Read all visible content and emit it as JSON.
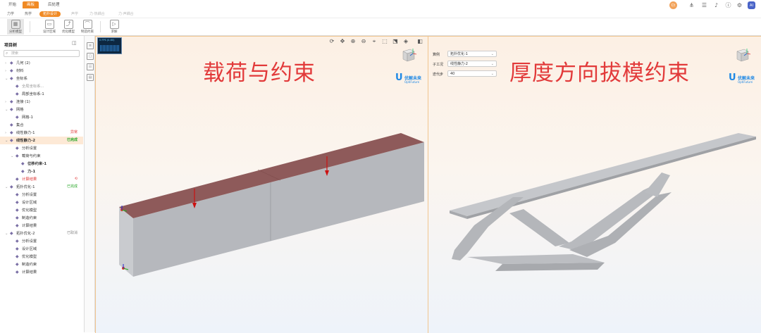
{
  "top_tabs": [
    "开始",
    "画板",
    "后处理"
  ],
  "top_tabs_active_index": 1,
  "top_right": {
    "user_initials": "Ct",
    "avatar_initials": "AI"
  },
  "ribbon_tabs": [
    "力学",
    "热学",
    "拓扑设计",
    "声学",
    "力·热耦合",
    "力·声耦合"
  ],
  "ribbon_active_index": 2,
  "tools": [
    {
      "label": "分析模型",
      "icon": "model-icon"
    },
    {
      "label": "设计区域",
      "icon": "design-region-icon"
    },
    {
      "label": "优化模型",
      "icon": "optimize-icon"
    },
    {
      "label": "制造约束",
      "icon": "manufacture-icon"
    },
    {
      "label": "求解",
      "icon": "solve-icon"
    }
  ],
  "project_tree": {
    "title": "项目树",
    "search_placeholder": "搜索",
    "items": [
      {
        "label": "几何 (2)",
        "indent": 0,
        "arrow": "›",
        "icon": "geometry-icon",
        "style": ""
      },
      {
        "label": "材料",
        "indent": 0,
        "arrow": "›",
        "icon": "material-icon",
        "style": ""
      },
      {
        "label": "坐标系",
        "indent": 0,
        "arrow": "⌄",
        "icon": "coordinate-icon",
        "style": ""
      },
      {
        "label": "全局坐标系...",
        "indent": 1,
        "arrow": "",
        "icon": "coordinate-icon",
        "style": "dim"
      },
      {
        "label": "局部坐标系-1",
        "indent": 1,
        "arrow": "",
        "icon": "coordinate-icon",
        "style": ""
      },
      {
        "label": "连接 (1)",
        "indent": 0,
        "arrow": "›",
        "icon": "connection-icon",
        "style": ""
      },
      {
        "label": "网格",
        "indent": 0,
        "arrow": "⌄",
        "icon": "mesh-icon",
        "style": ""
      },
      {
        "label": "网格-1",
        "indent": 1,
        "arrow": "",
        "icon": "mesh-icon",
        "style": ""
      },
      {
        "label": "集合",
        "indent": 0,
        "arrow": "",
        "icon": "set-icon",
        "style": ""
      },
      {
        "label": "线性静力-1",
        "indent": 0,
        "arrow": "›",
        "icon": "static-icon",
        "style": "",
        "badge": "异常",
        "badge_class": "b-red"
      },
      {
        "label": "线性静力-2",
        "indent": 0,
        "arrow": "⌄",
        "icon": "static-icon",
        "style": "bold sel",
        "badge": "已完成",
        "badge_class": "b-green"
      },
      {
        "label": "分析设置",
        "indent": 1,
        "arrow": "",
        "icon": "settings-icon",
        "style": ""
      },
      {
        "label": "载荷与约束",
        "indent": 1,
        "arrow": "⌄",
        "icon": "load-icon",
        "style": ""
      },
      {
        "label": "位移约束-1",
        "indent": 2,
        "arrow": "",
        "icon": "constraint-icon",
        "style": "bold"
      },
      {
        "label": "力-1",
        "indent": 2,
        "arrow": "",
        "icon": "force-icon",
        "style": "bold"
      },
      {
        "label": "计算结果",
        "indent": 1,
        "arrow": "",
        "icon": "result-icon",
        "style": "red",
        "badge": "⟲",
        "badge_class": "b-red"
      },
      {
        "label": "拓扑优化-1",
        "indent": 0,
        "arrow": "⌄",
        "icon": "topology-icon",
        "style": "",
        "badge": "已完成",
        "badge_class": "b-green"
      },
      {
        "label": "分析设置",
        "indent": 1,
        "arrow": "",
        "icon": "settings-icon",
        "style": ""
      },
      {
        "label": "设计区域",
        "indent": 1,
        "arrow": "",
        "icon": "design-region-icon",
        "style": ""
      },
      {
        "label": "优化模型",
        "indent": 1,
        "arrow": "",
        "icon": "optimize-icon",
        "style": ""
      },
      {
        "label": "制造约束",
        "indent": 1,
        "arrow": "",
        "icon": "manufacture-icon",
        "style": ""
      },
      {
        "label": "计算结果",
        "indent": 1,
        "arrow": "",
        "icon": "result-icon",
        "style": ""
      },
      {
        "label": "拓扑优化-2",
        "indent": 0,
        "arrow": "⌄",
        "icon": "topology-icon",
        "style": "",
        "badge": "已取消",
        "badge_class": "b-gray"
      },
      {
        "label": "分析设置",
        "indent": 1,
        "arrow": "",
        "icon": "settings-icon",
        "style": ""
      },
      {
        "label": "设计区域",
        "indent": 1,
        "arrow": "",
        "icon": "design-region-icon",
        "style": ""
      },
      {
        "label": "优化模型",
        "indent": 1,
        "arrow": "",
        "icon": "optimize-icon",
        "style": ""
      },
      {
        "label": "制造约束",
        "indent": 1,
        "arrow": "",
        "icon": "manufacture-icon",
        "style": ""
      },
      {
        "label": "计算结果",
        "indent": 1,
        "arrow": "",
        "icon": "result-icon",
        "style": ""
      }
    ]
  },
  "viewport1": {
    "title": "载荷与约束",
    "minimap_text": "0 FPS (0-60)"
  },
  "viewport2": {
    "title": "厚度方向拔模约束",
    "props": [
      {
        "label": "算例",
        "value": "拓扑优化-1"
      },
      {
        "label": "子工况",
        "value": "线性静力-2"
      },
      {
        "label": "迭代步",
        "value": "40"
      }
    ]
  },
  "logo": {
    "cn": "优解未来",
    "en": "OptiFuture",
    "mark": "U"
  },
  "colors": {
    "accent": "#f08a24",
    "title_red": "#e23a3a",
    "load_face": "#8e5a5a",
    "part_gray": "#b6b8bd"
  }
}
